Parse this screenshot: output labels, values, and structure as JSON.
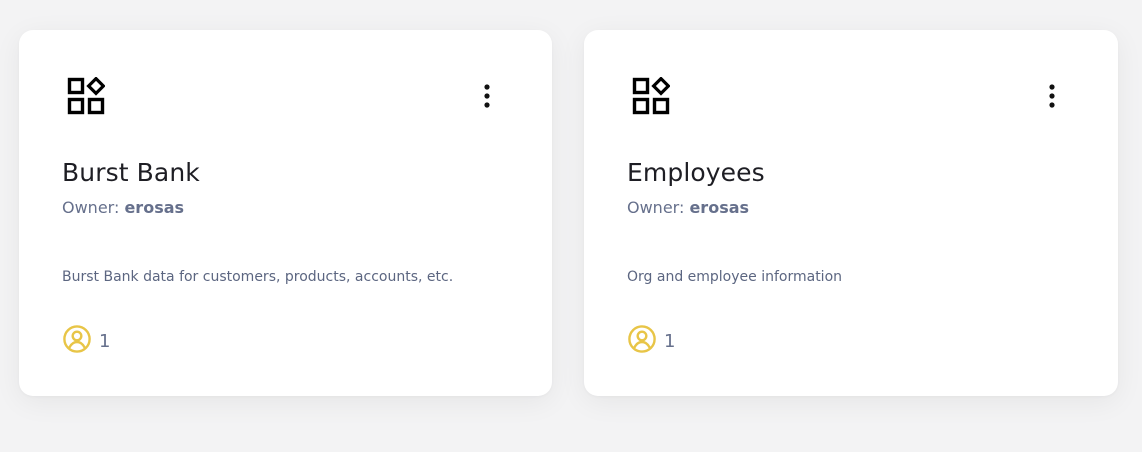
{
  "colors": {
    "page_background": "#f3f3f4",
    "card_background": "#ffffff",
    "title": "#1e1e24",
    "muted_text": "#66708c",
    "member_icon": "#e8c547",
    "app_icon": "#000000"
  },
  "cards": [
    {
      "icon": "shapes-icon",
      "menu_icon": "kebab-menu-icon",
      "title": "Burst Bank",
      "owner_label": "Owner:",
      "owner_name": "erosas",
      "description": "Burst Bank data for customers, products, accounts, etc.",
      "member_icon": "user-circle-icon",
      "member_count": "1"
    },
    {
      "icon": "shapes-icon",
      "menu_icon": "kebab-menu-icon",
      "title": "Employees",
      "owner_label": "Owner:",
      "owner_name": "erosas",
      "description": "Org and employee information",
      "member_icon": "user-circle-icon",
      "member_count": "1"
    }
  ]
}
